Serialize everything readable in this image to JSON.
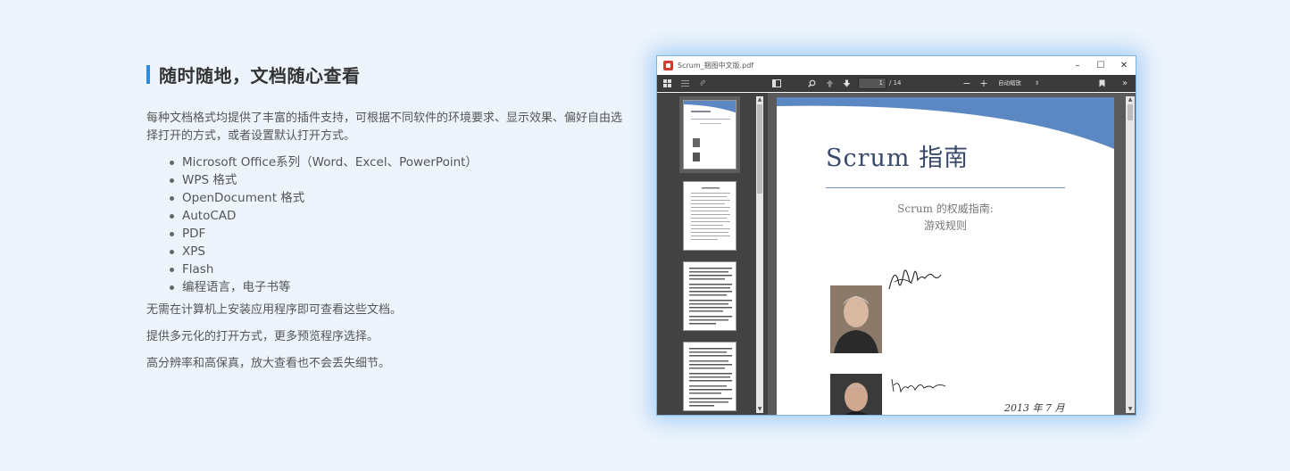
{
  "section": {
    "title": "随时随地，文档随心查看",
    "intro": "每种文档格式均提供了丰富的插件支持，可根据不同软件的环境要求、显示效果、偏好自由选择打开的方式，或者设置默认打开方式。",
    "formats": [
      "Microsoft Office系列（Word、Excel、PowerPoint）",
      "WPS 格式",
      "OpenDocument 格式",
      "AutoCAD",
      "PDF",
      "XPS",
      "Flash",
      "编程语言，电子书等"
    ],
    "paragraphs": [
      "无需在计算机上安装应用程序即可查看这些文档。",
      "提供多元化的打开方式，更多预览程序选择。",
      "高分辨率和高保真，放大查看也不会丢失细节。"
    ]
  },
  "window": {
    "title": "Scrum_捆图中文版.pdf",
    "controls": {
      "minimize": "–",
      "maximize": "☐",
      "close": "✕"
    }
  },
  "toolbar": {
    "page_current": "1",
    "page_total": "/ 14",
    "zoom_minus": "−",
    "zoom_plus": "+",
    "zoom_value": "自动缩放"
  },
  "document": {
    "title": "Scrum 指南",
    "subtitle_line1": "Scrum 的权威指南:",
    "subtitle_line2": "游戏规则",
    "date": "2013 年 7 月"
  },
  "icons": {
    "thumbnails": "grid-icon",
    "outline": "list-icon",
    "attachments": "paperclip-icon",
    "sidebar_toggle": "sidebar-toggle-icon",
    "search": "search-icon",
    "prev_page": "arrow-up-icon",
    "next_page": "arrow-down-icon",
    "bookmark": "bookmark-icon",
    "more": "double-chevron-icon"
  },
  "colors": {
    "accent": "#2b8ce0",
    "background": "#edf4fc",
    "toolbar": "#3b3b3b",
    "sidebar": "#424242",
    "doc_banner": "#5b88c3"
  }
}
